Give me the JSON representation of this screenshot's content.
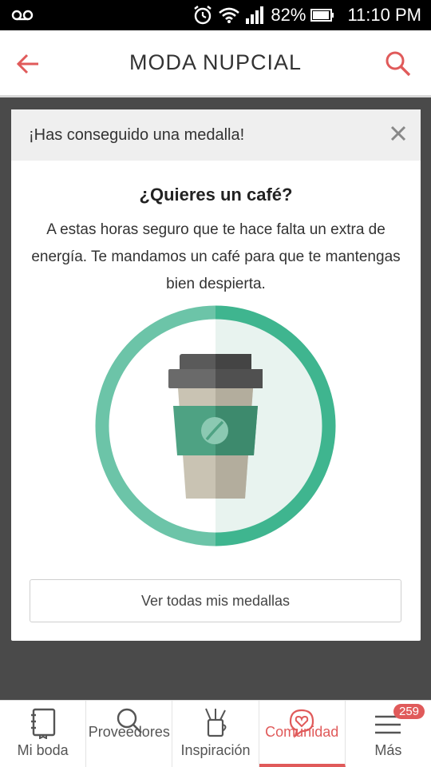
{
  "status_bar": {
    "battery": "82%",
    "time": "11:10 PM",
    "icons": [
      "voicemail-icon",
      "alarm-icon",
      "wifi-icon",
      "signal-icon",
      "battery-icon"
    ]
  },
  "header": {
    "title": "MODA NUPCIAL",
    "accent_color": "#e05a5a"
  },
  "modal": {
    "header_text": "¡Has conseguido una medalla!",
    "title": "¿Quieres un café?",
    "body": "A estas horas seguro que te hace falta un extra de energía. Te mandamos un café para que te mantengas bien despierta.",
    "button_label": "Ver todas mis medallas",
    "medal_color": "#3fb58f"
  },
  "bottom_nav": {
    "items": [
      {
        "label": "Mi boda",
        "icon": "notebook-icon"
      },
      {
        "label": "Proveedores",
        "icon": "search-icon"
      },
      {
        "label": "Inspiración",
        "icon": "pencil-cup-icon"
      },
      {
        "label": "Comunidad",
        "icon": "heart-chat-icon",
        "active": true
      },
      {
        "label": "Más",
        "icon": "menu-icon",
        "badge": "259"
      }
    ]
  }
}
